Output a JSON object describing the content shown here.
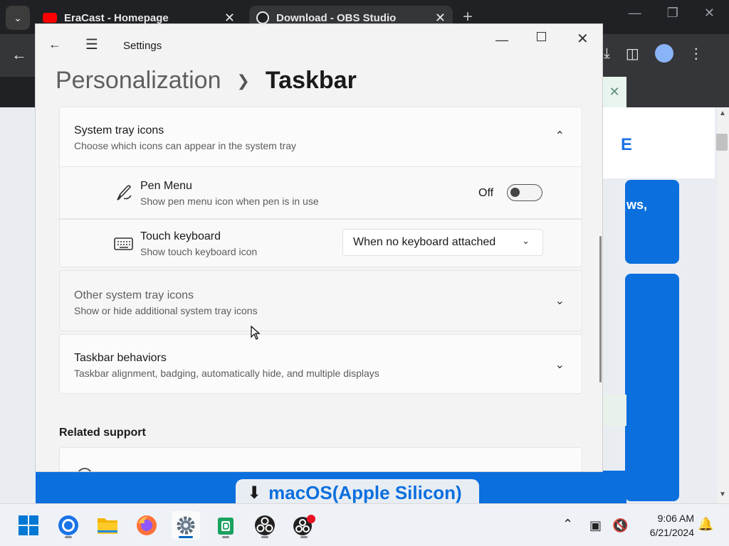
{
  "browser": {
    "tabs": [
      {
        "label": "EraCast - Homepage",
        "icon": "youtube-icon"
      },
      {
        "label": "Download - OBS Studio",
        "icon": "obs-icon"
      }
    ],
    "page_fragment_text": "ws,",
    "page_fragment_letter": "E",
    "mac_button_label": "macOS(Apple Silicon)"
  },
  "settings": {
    "window_title": "Settings",
    "breadcrumb": {
      "parent": "Personalization",
      "current": "Taskbar"
    },
    "system_tray": {
      "title": "System tray icons",
      "subtitle": "Choose which icons can appear in the system tray",
      "expanded": true,
      "items": {
        "pen_menu": {
          "title": "Pen Menu",
          "subtitle": "Show pen menu icon when pen is in use",
          "state_label": "Off",
          "on": false
        },
        "touch_keyboard": {
          "title": "Touch keyboard",
          "subtitle": "Show touch keyboard icon",
          "selected": "When no keyboard attached"
        }
      }
    },
    "other_tray": {
      "title": "Other system tray icons",
      "subtitle": "Show or hide additional system tray icons"
    },
    "behaviors": {
      "title": "Taskbar behaviors",
      "subtitle": "Taskbar alignment, badging, automatically hide, and multiple displays"
    },
    "related": {
      "heading": "Related support"
    }
  },
  "taskbar": {
    "time": "9:06 AM",
    "date": "6/21/2024",
    "apps": [
      "start-icon",
      "chrome-icon",
      "file-explorer-icon",
      "firefox-icon",
      "settings-icon",
      "app-icon",
      "obs-icon",
      "obs-recording-icon"
    ]
  },
  "colors": {
    "accent": "#0067c0",
    "web_blue": "#0b6fde",
    "window_bg": "#f3f3f3"
  }
}
